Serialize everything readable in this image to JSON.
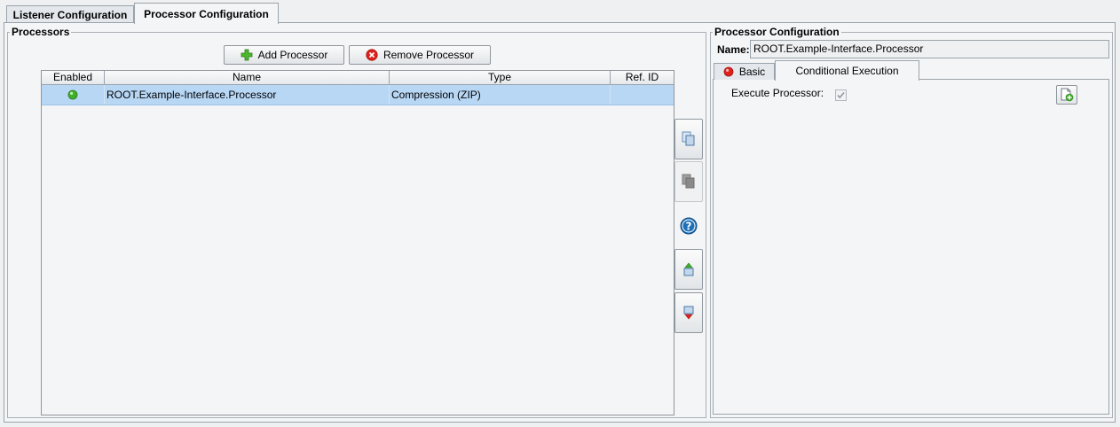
{
  "top_tabs": [
    {
      "label": "Listener Configuration",
      "active": false
    },
    {
      "label": "Processor Configuration",
      "active": true
    }
  ],
  "processors": {
    "title": "Processors",
    "add_label": "Add Processor",
    "remove_label": "Remove Processor",
    "columns": [
      "Enabled",
      "Name",
      "Type",
      "Ref. ID"
    ],
    "rows": [
      {
        "enabled": true,
        "name": "ROOT.Example-Interface.Processor",
        "type": "Compression (ZIP)",
        "ref_id": ""
      }
    ]
  },
  "side_buttons": [
    {
      "icon": "copy-icon",
      "enabled": true
    },
    {
      "icon": "paste-icon",
      "enabled": false
    },
    {
      "icon": "help-icon",
      "enabled": true
    },
    {
      "icon": "move-up-icon",
      "enabled": true
    },
    {
      "icon": "move-down-icon",
      "enabled": true
    }
  ],
  "config": {
    "title": "Processor Configuration",
    "name_label": "Name:",
    "name_value": "ROOT.Example-Interface.Processor",
    "tabs": [
      {
        "label": "Basic",
        "active": false,
        "error": true
      },
      {
        "label": "Conditional Execution",
        "active": true
      }
    ],
    "execute_label": "Execute Processor:",
    "execute_checked": true
  },
  "colors": {
    "selection": "#b8d7f5",
    "error": "#e0211b",
    "ok": "#3fae2a"
  }
}
